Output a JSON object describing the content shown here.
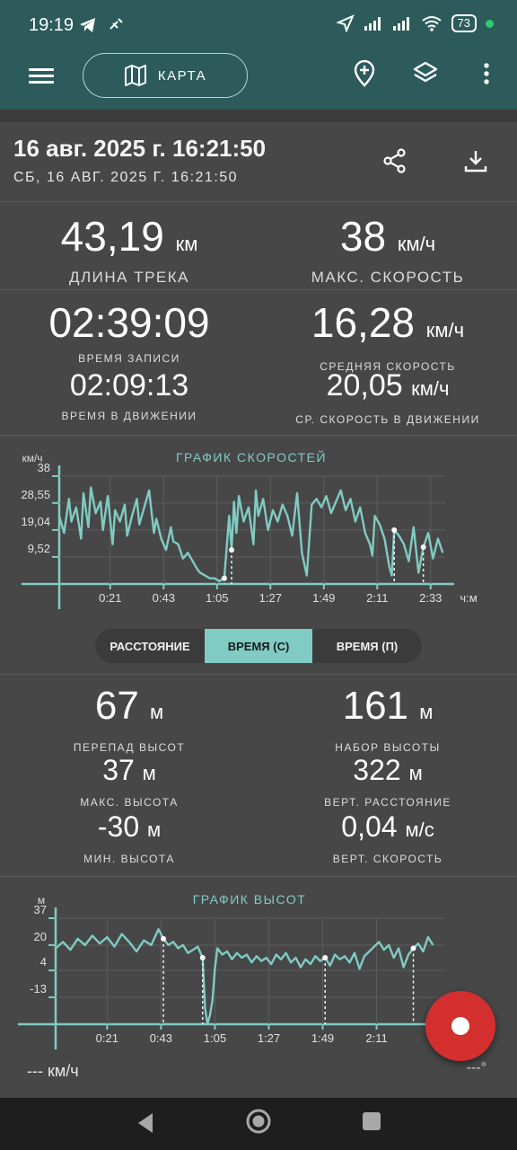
{
  "status_bar": {
    "time": "19:19",
    "battery": "73"
  },
  "toolbar": {
    "map_label": "КАРТА",
    "accent": "#2d5b5b"
  },
  "track": {
    "title": "16 авг. 2025 г. 16:21:50",
    "subtitle": "СБ, 16 АВГ. 2025 Г. 16:21:50"
  },
  "stats": {
    "length": {
      "value": "43,19",
      "unit": "км",
      "label": "ДЛИНА ТРЕКА"
    },
    "max_speed": {
      "value": "38",
      "unit": "км/ч",
      "label": "МАКС. СКОРОСТЬ"
    },
    "record_time": {
      "value": "02:39:09",
      "label": "ВРЕМЯ ЗАПИСИ"
    },
    "avg_speed": {
      "value": "16,28",
      "unit": "км/ч",
      "label": "СРЕДНЯЯ СКОРОСТЬ"
    },
    "moving_time": {
      "value": "02:09:13",
      "label": "ВРЕМЯ В ДВИЖЕНИИ"
    },
    "avg_moving_speed": {
      "value": "20,05",
      "unit": "км/ч",
      "label": "СР. СКОРОСТЬ В ДВИЖЕНИИ"
    }
  },
  "segment": {
    "options": [
      "РАССТОЯНИЕ",
      "ВРЕМЯ (С)",
      "ВРЕМЯ (П)"
    ],
    "selected": "ВРЕМЯ (С)"
  },
  "altitude": {
    "drop": {
      "value": "67",
      "unit": "м",
      "label": "ПЕРЕПАД ВЫСОТ"
    },
    "gain": {
      "value": "161",
      "unit": "м",
      "label": "НАБОР ВЫСОТЫ"
    },
    "max": {
      "value": "37",
      "unit": "м",
      "label": "МАКС. ВЫСОТА"
    },
    "vert_dist": {
      "value": "322",
      "unit": "м",
      "label": "ВЕРТ. РАССТОЯНИЕ"
    },
    "min": {
      "value": "-30",
      "unit": "м",
      "label": "МИН. ВЫСОТА"
    },
    "vert_speed": {
      "value": "0,04",
      "unit": "м/с",
      "label": "ВЕРТ. СКОРОСТЬ"
    }
  },
  "bottom": {
    "speed": "--- км/ч",
    "bearing": "---°"
  },
  "chart_data": [
    {
      "type": "line",
      "title": "ГРАФИК СКОРОСТЕЙ",
      "ylabel": "км/ч",
      "xlabel": "ч:м",
      "y_ticks": [
        "38",
        "28,55",
        "19,04",
        "9,52"
      ],
      "x_ticks": [
        "0:21",
        "0:43",
        "1:05",
        "1:27",
        "1:49",
        "2:11",
        "2:33"
      ],
      "ylim": [
        0,
        38
      ],
      "xlim_min": [
        0,
        159
      ],
      "series_color": "#80cbc4",
      "x": [
        0,
        2,
        4,
        5,
        7,
        9,
        10,
        12,
        13,
        15,
        17,
        18,
        20,
        22,
        23,
        25,
        27,
        28,
        30,
        32,
        33,
        35,
        37,
        39,
        40,
        42,
        44,
        46,
        47,
        49,
        51,
        53,
        55,
        57,
        58,
        60,
        62,
        64,
        66,
        68,
        70,
        71,
        72,
        73,
        74,
        76,
        78,
        80,
        81,
        82,
        84,
        86,
        88,
        90,
        92,
        94,
        96,
        98,
        100,
        102,
        104,
        106,
        108,
        110,
        112,
        114,
        116,
        118,
        120,
        122,
        124,
        126,
        128,
        129,
        130,
        132,
        134,
        136,
        137,
        138,
        140,
        142,
        144,
        146,
        148,
        150,
        152,
        154,
        156,
        158
      ],
      "values": [
        24,
        18,
        30,
        22,
        27,
        16,
        32,
        20,
        34,
        25,
        29,
        19,
        31,
        14,
        26,
        22,
        28,
        17,
        24,
        30,
        21,
        27,
        33,
        18,
        23,
        16,
        12,
        20,
        15,
        14,
        9,
        11,
        8,
        5,
        4,
        3,
        2,
        2,
        1,
        2,
        24,
        12,
        29,
        18,
        31,
        22,
        27,
        14,
        33,
        24,
        30,
        19,
        26,
        22,
        28,
        24,
        17,
        32,
        11,
        3,
        28,
        30,
        27,
        31,
        25,
        29,
        33,
        26,
        30,
        22,
        27,
        18,
        14,
        10,
        24,
        21,
        16,
        6,
        3,
        19,
        17,
        14,
        8,
        20,
        4,
        13,
        18,
        9,
        16,
        11
      ]
    },
    {
      "type": "line",
      "title": "ГРАФИК ВЫСОТ",
      "ylabel": "м",
      "y_ticks": [
        "37",
        "20",
        "4",
        "-13"
      ],
      "x_ticks": [
        "0:21",
        "0:43",
        "1:05",
        "1:27",
        "1:49",
        "2:11"
      ],
      "ylim": [
        -30,
        37
      ],
      "xlim_min": [
        0,
        159
      ],
      "series_color": "#80cbc4",
      "x": [
        0,
        3,
        6,
        9,
        12,
        15,
        18,
        21,
        24,
        27,
        30,
        33,
        36,
        39,
        42,
        44,
        46,
        48,
        50,
        52,
        54,
        56,
        58,
        60,
        61,
        62,
        63,
        64,
        65,
        66,
        68,
        70,
        72,
        74,
        76,
        78,
        80,
        82,
        84,
        86,
        88,
        90,
        92,
        94,
        96,
        98,
        100,
        102,
        104,
        106,
        108,
        110,
        112,
        114,
        116,
        118,
        120,
        122,
        124,
        126,
        128,
        130,
        132,
        134,
        136,
        138,
        140,
        142,
        144,
        146,
        148,
        150,
        152,
        154,
        156,
        158
      ],
      "values": [
        18,
        22,
        17,
        24,
        20,
        26,
        21,
        25,
        19,
        27,
        22,
        16,
        23,
        20,
        30,
        24,
        20,
        22,
        18,
        20,
        15,
        17,
        19,
        12,
        -20,
        -30,
        -24,
        -15,
        5,
        18,
        14,
        16,
        11,
        15,
        12,
        14,
        9,
        13,
        10,
        12,
        8,
        14,
        11,
        15,
        9,
        12,
        6,
        11,
        8,
        13,
        10,
        12,
        7,
        14,
        11,
        13,
        9,
        15,
        5,
        13,
        16,
        19,
        22,
        17,
        20,
        12,
        18,
        6,
        14,
        18,
        21,
        16,
        25,
        20
      ]
    }
  ]
}
